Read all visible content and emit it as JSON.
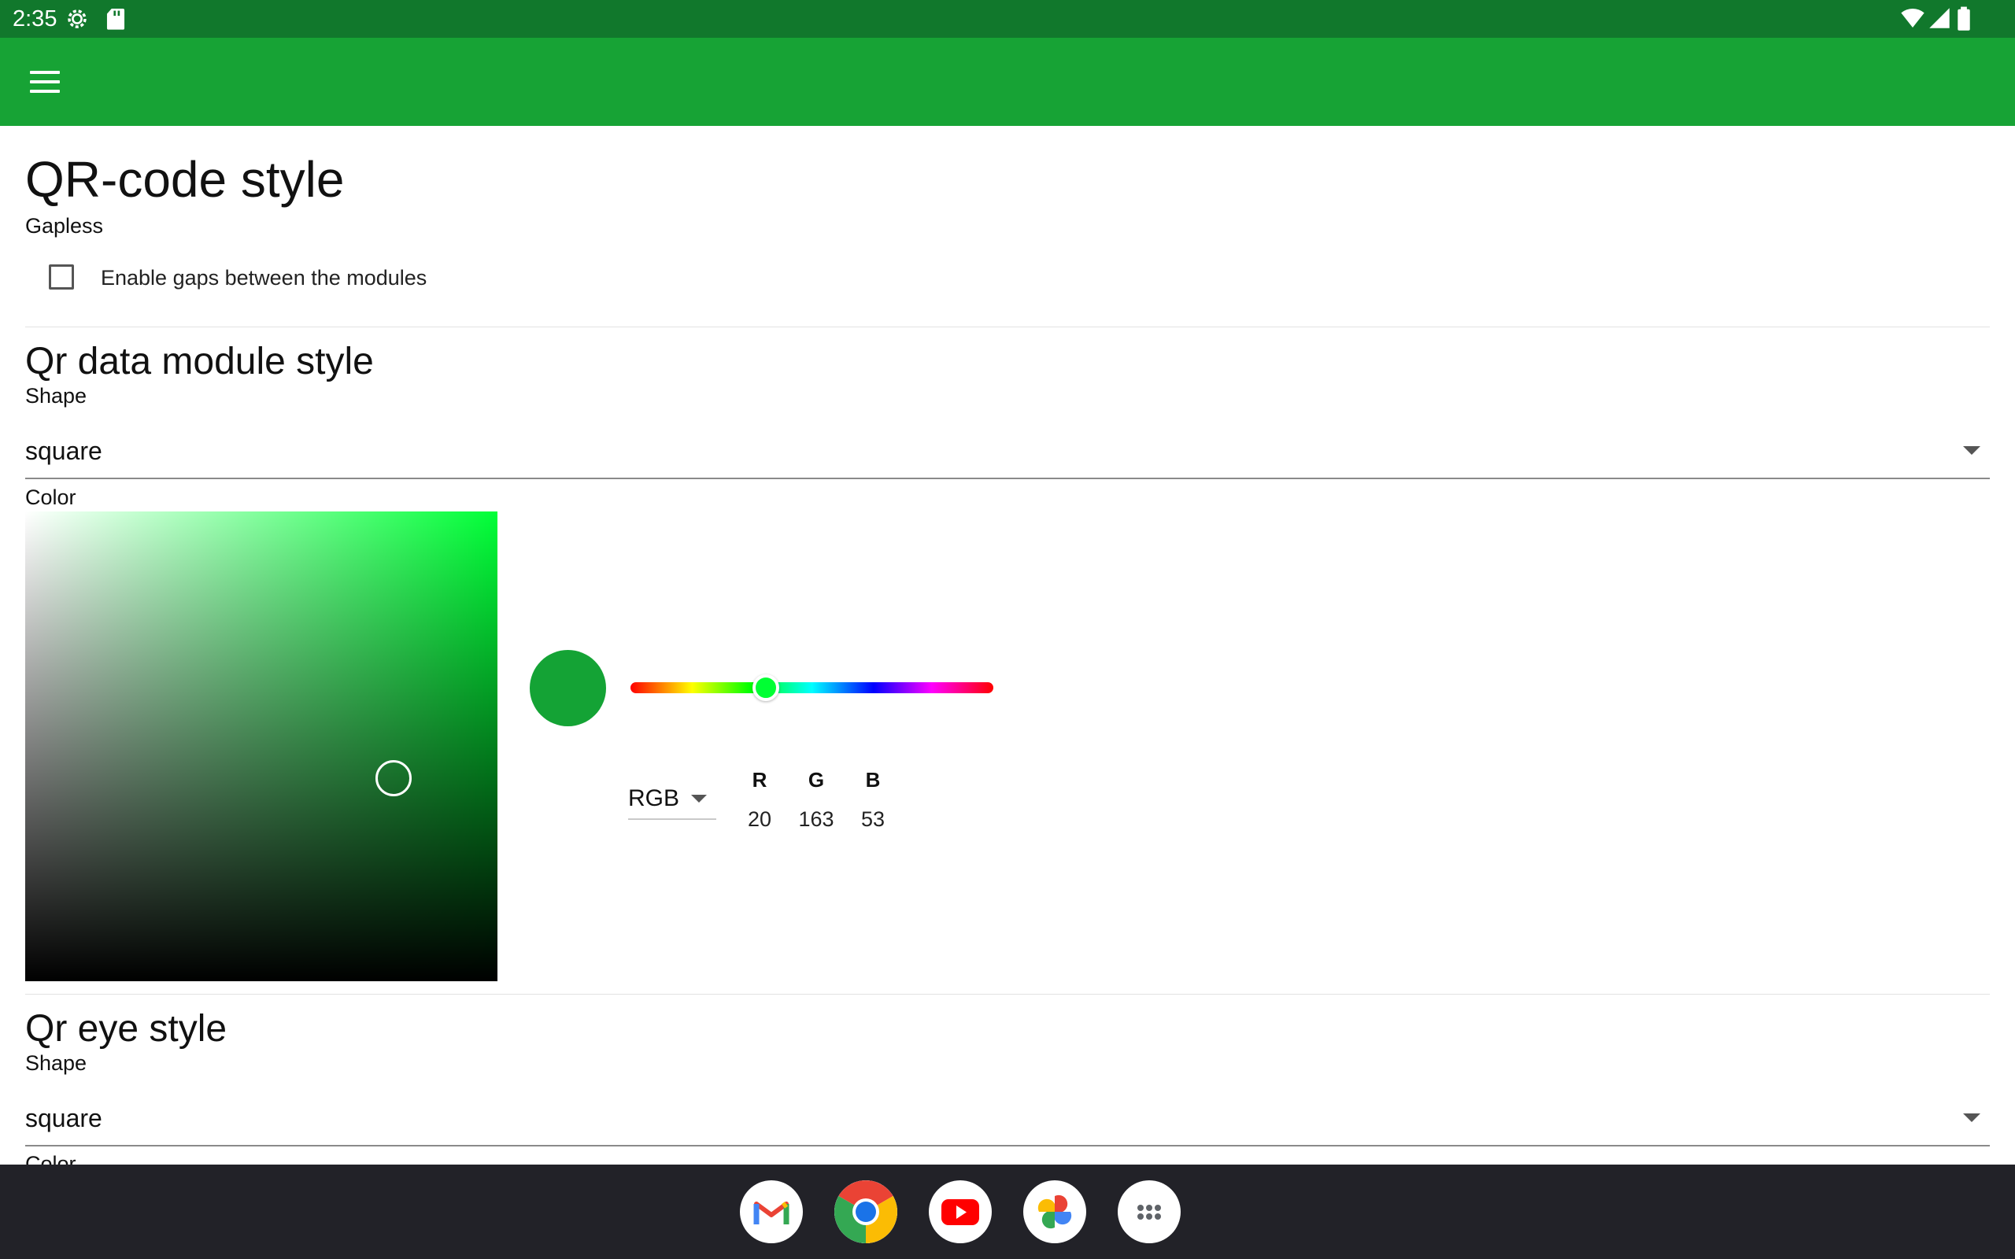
{
  "status_bar": {
    "time": "2:35",
    "left_icons": [
      "settings-icon",
      "sd-card-icon"
    ],
    "right_icons": [
      "wifi-icon",
      "signal-icon",
      "battery-icon"
    ]
  },
  "app_bar": {
    "menu_icon": "menu-icon",
    "color": "#17a335"
  },
  "page": {
    "title": "QR-code style",
    "gapless": {
      "label": "Gapless",
      "checkbox_label": "Enable gaps between the modules",
      "checked": false
    },
    "data_module": {
      "heading": "Qr data module style",
      "shape_label": "Shape",
      "shape_value": "square",
      "color_label": "Color",
      "picker": {
        "mode": "RGB",
        "channels": [
          "R",
          "G",
          "B"
        ],
        "values": [
          "20",
          "163",
          "53"
        ],
        "swatch_color": "#14a335"
      }
    },
    "eye": {
      "heading": "Qr eye style",
      "shape_label": "Shape",
      "shape_value": "square",
      "color_label": "Color"
    }
  },
  "dock": {
    "apps": [
      "gmail-icon",
      "chrome-icon",
      "youtube-icon",
      "photos-icon",
      "app-drawer-icon"
    ]
  }
}
